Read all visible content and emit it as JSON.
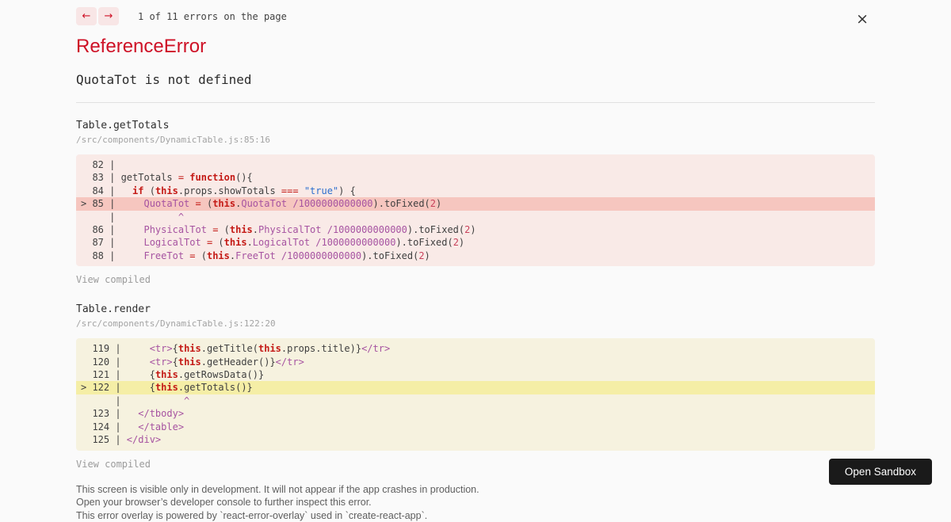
{
  "header": {
    "left_arrow": "←",
    "right_arrow": "→",
    "counter": "1 of 11 errors on the page",
    "close_label": "×"
  },
  "error": {
    "name": "ReferenceError",
    "message": "QuotaTot is not defined"
  },
  "frames": [
    {
      "fn": "Table.getTotals",
      "path": "/src/components/DynamicTable.js:85:16",
      "variant": "error",
      "view_compiled": "View compiled",
      "lines": [
        {
          "hl": false,
          "seg": [
            [
              "  82 | ",
              "d"
            ]
          ]
        },
        {
          "hl": false,
          "seg": [
            [
              "  83 | ",
              "d"
            ],
            [
              "getTotals ",
              "d"
            ],
            [
              "= ",
              "op"
            ],
            [
              "function",
              "kw"
            ],
            [
              "(){",
              "d"
            ]
          ]
        },
        {
          "hl": false,
          "seg": [
            [
              "  84 |   ",
              "d"
            ],
            [
              "if ",
              "kw"
            ],
            [
              "(",
              "d"
            ],
            [
              "this",
              "kw"
            ],
            [
              ".props.showTotals ",
              "d"
            ],
            [
              "=== ",
              "op"
            ],
            [
              "\"true\"",
              "str"
            ],
            [
              ") {",
              "d"
            ]
          ]
        },
        {
          "hl": true,
          "seg": [
            [
              "> 85 |     ",
              "d"
            ],
            [
              "QuotaTot ",
              "id"
            ],
            [
              "= ",
              "op"
            ],
            [
              "(",
              "d"
            ],
            [
              "this",
              "kw"
            ],
            [
              ".",
              "d"
            ],
            [
              "QuotaTot ",
              "id"
            ],
            [
              "/1000000000000",
              "num"
            ],
            [
              ").toFixed(",
              "d"
            ],
            [
              "2",
              "num2"
            ],
            [
              ")",
              "d"
            ]
          ]
        },
        {
          "hl": false,
          "seg": [
            [
              "     |           ",
              "d"
            ],
            [
              "^",
              "caret"
            ]
          ]
        },
        {
          "hl": false,
          "seg": [
            [
              "  86 |     ",
              "d"
            ],
            [
              "PhysicalTot ",
              "id"
            ],
            [
              "= ",
              "op"
            ],
            [
              "(",
              "d"
            ],
            [
              "this",
              "kw"
            ],
            [
              ".",
              "d"
            ],
            [
              "PhysicalTot ",
              "id"
            ],
            [
              "/1000000000000",
              "num"
            ],
            [
              ").toFixed(",
              "d"
            ],
            [
              "2",
              "num2"
            ],
            [
              ")",
              "d"
            ]
          ]
        },
        {
          "hl": false,
          "seg": [
            [
              "  87 |     ",
              "d"
            ],
            [
              "LogicalTot ",
              "id"
            ],
            [
              "= ",
              "op"
            ],
            [
              "(",
              "d"
            ],
            [
              "this",
              "kw"
            ],
            [
              ".",
              "d"
            ],
            [
              "LogicalTot ",
              "id"
            ],
            [
              "/1000000000000",
              "num"
            ],
            [
              ").toFixed(",
              "d"
            ],
            [
              "2",
              "num2"
            ],
            [
              ")",
              "d"
            ]
          ]
        },
        {
          "hl": false,
          "seg": [
            [
              "  88 |     ",
              "d"
            ],
            [
              "FreeTot ",
              "id"
            ],
            [
              "= ",
              "op"
            ],
            [
              "(",
              "d"
            ],
            [
              "this",
              "kw"
            ],
            [
              ".",
              "d"
            ],
            [
              "FreeTot ",
              "id"
            ],
            [
              "/1000000000000",
              "num"
            ],
            [
              ").toFixed(",
              "d"
            ],
            [
              "2",
              "num2"
            ],
            [
              ")",
              "d"
            ]
          ]
        }
      ]
    },
    {
      "fn": "Table.render",
      "path": "/src/components/DynamicTable.js:122:20",
      "variant": "warning",
      "view_compiled": "View compiled",
      "lines": [
        {
          "hl": false,
          "seg": [
            [
              "  119 |     ",
              "d"
            ],
            [
              "<tr>",
              "tag"
            ],
            [
              "{",
              "d"
            ],
            [
              "this",
              "kw"
            ],
            [
              ".getTitle(",
              "d"
            ],
            [
              "this",
              "kw"
            ],
            [
              ".props.title)}",
              "d"
            ],
            [
              "</tr>",
              "tag"
            ]
          ]
        },
        {
          "hl": false,
          "seg": [
            [
              "  120 |     ",
              "d"
            ],
            [
              "<tr>",
              "tag"
            ],
            [
              "{",
              "d"
            ],
            [
              "this",
              "kw"
            ],
            [
              ".getHeader()}",
              "d"
            ],
            [
              "</tr>",
              "tag"
            ]
          ]
        },
        {
          "hl": false,
          "seg": [
            [
              "  121 |     ",
              "d"
            ],
            [
              "{",
              "d"
            ],
            [
              "this",
              "kw"
            ],
            [
              ".getRowsData()}",
              "d"
            ]
          ]
        },
        {
          "hl": true,
          "seg": [
            [
              "> 122 |     ",
              "d"
            ],
            [
              "{",
              "d"
            ],
            [
              "this",
              "kw"
            ],
            [
              ".getTotals()}",
              "d"
            ]
          ]
        },
        {
          "hl": false,
          "seg": [
            [
              "      |           ",
              "d"
            ],
            [
              "^",
              "caret"
            ]
          ]
        },
        {
          "hl": false,
          "seg": [
            [
              "  123 |   ",
              "d"
            ],
            [
              "</tbody>",
              "tag"
            ]
          ]
        },
        {
          "hl": false,
          "seg": [
            [
              "  124 |   ",
              "d"
            ],
            [
              "</table>",
              "tag"
            ]
          ]
        },
        {
          "hl": false,
          "seg": [
            [
              "  125 | ",
              "d"
            ],
            [
              "</div>",
              "tag"
            ]
          ]
        }
      ]
    }
  ],
  "footer": {
    "lines": [
      "This screen is visible only in development. It will not appear if the app crashes in production.",
      "Open your browser’s developer console to further inspect this error.",
      "This error overlay is powered by `react-error-overlay` used in `create-react-app`."
    ]
  },
  "sandbox": {
    "button_label": "Open Sandbox"
  },
  "colors": {
    "accent_red": "#ce1126",
    "keyword_red": "#c41a16",
    "identifier_purple": "#a653a1",
    "string_blue": "#2c6fce",
    "number_pink": "#c8415b",
    "error_frame_bg": "#f9eae7",
    "error_frame_highlight": "#f6c6bf",
    "warning_frame_bg": "#f6f2df",
    "warning_frame_highlight": "#f5eea6",
    "page_bg": "#fafafa",
    "sandbox_button_bg": "#1a1a1a"
  }
}
